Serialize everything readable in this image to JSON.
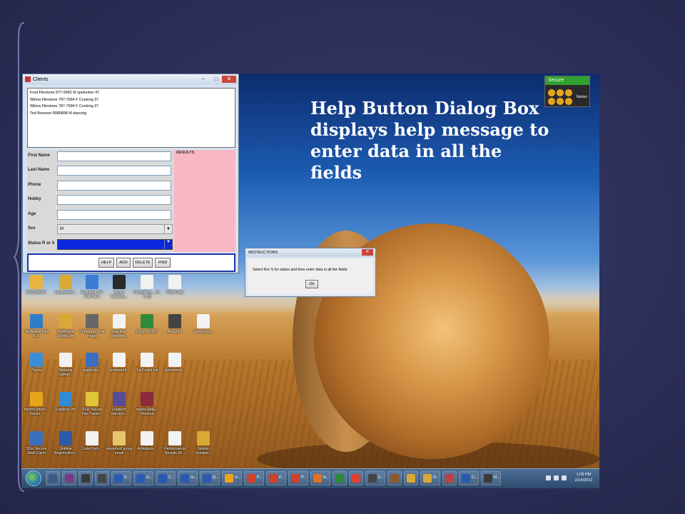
{
  "slide": {
    "caption_lines": [
      "Help Button Dialog Box",
      "displays help message to",
      "enter data in all the",
      "fields"
    ]
  },
  "norton_widget": {
    "status": "Secure",
    "brand": "Norton"
  },
  "clients_window": {
    "title": "Clients",
    "title_buttons": [
      "–",
      "□",
      "✕"
    ],
    "records": [
      "Fred Flinstone 877-9942 M spelunker 47",
      "Wilma Flinstone 787-7994 F Cooking 37",
      "Wilma Flinstone 787-7994 F Cooking 37",
      "Ted Branson 8989898 M dancing"
    ],
    "fields": {
      "first_name": "First Name",
      "last_name": "Last Name",
      "phone": "Phone",
      "hobby": "Hobby",
      "age": "Age",
      "sex": "Sex",
      "status": "Status R or S"
    },
    "sex_value": "M",
    "results_label": "RESULTS",
    "buttons": {
      "help": "HELP",
      "add": "ADD",
      "delete": "DELETE",
      "find": "FIND"
    }
  },
  "instructions_dialog": {
    "title": "INSTRUCTIONS",
    "message": "Select Ror S for status and then enter data in all the fields",
    "ok": "OK"
  },
  "desktop_icons": [
    {
      "label": "DICOMDAT",
      "color": "#e8b440"
    },
    {
      "label": "expandedS...",
      "color": "#d9a936"
    },
    {
      "label": "EarthLink PC FineTune",
      "color": "#3c7bd4"
    },
    {
      "label": "Sonos Desktop...",
      "color": "#2a2a2a"
    },
    {
      "label": "HelwgProp... (9-1-11)",
      "color": "#f2f2f2"
    },
    {
      "label": "PSD Code",
      "color": "#f2f2f2"
    },
    {
      "label": "NetBeans IDE 6.8",
      "color": "#2f7dc8"
    },
    {
      "label": "NetBeans ShortCuts",
      "color": "#d9a936"
    },
    {
      "label": "Christmas Tree Image",
      "color": "#666666"
    },
    {
      "label": "Hav Res Residen...",
      "color": "#f2f2f2"
    },
    {
      "label": "Copy of 1827",
      "color": "#2f8a3a"
    },
    {
      "label": "ArrayList",
      "color": "#444444"
    },
    {
      "label": "GreekTrip...",
      "color": "#f2f2f2"
    },
    {
      "label": "iTunes",
      "color": "#3a8ed8"
    },
    {
      "label": "Resume Cathen...",
      "color": "#f2f2f2"
    },
    {
      "label": "registrybo...",
      "color": "#3a6fc0"
    },
    {
      "label": "Homework...",
      "color": "#f2f2f2"
    },
    {
      "label": "TaxCostsLink",
      "color": "#f2f2f2"
    },
    {
      "label": "Homework...",
      "color": "#f2f2f2"
    },
    {
      "label": "Norton Intern... Securi...",
      "color": "#e8a51a"
    },
    {
      "label": "Logitech Vid",
      "color": "#2e8bd6"
    },
    {
      "label": "SSH Secure File Transf...",
      "color": "#e0c43a"
    },
    {
      "label": "Logitech Harmon...",
      "color": "#5a4a9a"
    },
    {
      "label": "drjava-beta... Shortcut",
      "color": "#8a2a3a"
    },
    {
      "label": "SSH Secure Shell Client",
      "color": "#3a6fc0"
    },
    {
      "label": "Uniblue RegistryBoo...",
      "color": "#2a5aa8"
    },
    {
      "label": "ListerDem...",
      "color": "#f2f2f2"
    },
    {
      "label": "Haverford group email",
      "color": "#e8c46a"
    },
    {
      "label": "Antialiasin...",
      "color": "#f2f2f2"
    },
    {
      "label": "Performance Results 20...",
      "color": "#f2f2f2"
    },
    {
      "label": "Norton Installat...",
      "color": "#d9a936"
    }
  ],
  "taskbar": {
    "items": [
      {
        "label": "",
        "color": "#3a5a8a"
      },
      {
        "label": "",
        "color": "#7a3a8a"
      },
      {
        "label": "",
        "color": "#3a3a3a"
      },
      {
        "label": "",
        "color": "#444444"
      },
      {
        "label": "C...",
        "color": "#2a5ab0"
      },
      {
        "label": "H...",
        "color": "#2a5ab0"
      },
      {
        "label": "C...",
        "color": "#2a5ab0"
      },
      {
        "label": "In...",
        "color": "#2a5ab0"
      },
      {
        "label": "Q...",
        "color": "#2a5ab0"
      },
      {
        "label": "In...",
        "color": "#e8a51a"
      },
      {
        "label": "P...",
        "color": "#d0402a"
      },
      {
        "label": "P...",
        "color": "#d0402a"
      },
      {
        "label": "P...",
        "color": "#d0402a"
      },
      {
        "label": "lo...",
        "color": "#e07020"
      },
      {
        "label": "",
        "color": "#2a8a3a"
      },
      {
        "label": "",
        "color": "#e04030"
      },
      {
        "label": "C...",
        "color": "#444444"
      },
      {
        "label": "",
        "color": "#8a5a2a"
      },
      {
        "label": "",
        "color": "#d9a936"
      },
      {
        "label": "D...",
        "color": "#d9a936"
      },
      {
        "label": "",
        "color": "#c04040"
      },
      {
        "label": "C...",
        "color": "#2a5ab0"
      },
      {
        "label": "N...",
        "color": "#3a3a3a"
      }
    ],
    "clock_time": "1:09 PM",
    "clock_date": "2/14/2012"
  }
}
